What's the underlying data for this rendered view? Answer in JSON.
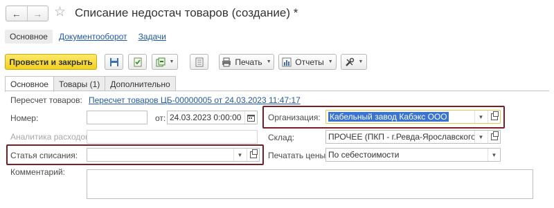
{
  "window": {
    "title": "Списание недостач товаров (создание) *",
    "icons": {
      "back": "arrow-left-icon",
      "forward": "arrow-right-icon",
      "favorite": "star-icon"
    }
  },
  "section_tabs": [
    {
      "label": "Основное"
    },
    {
      "label": "Документооборот"
    },
    {
      "label": "Задачи"
    }
  ],
  "toolbar": {
    "post_close_label": "Провести и закрыть",
    "print_label": "Печать",
    "reports_label": "Отчеты"
  },
  "form_tabs": [
    {
      "label": "Основное"
    },
    {
      "label": "Товары (1)"
    },
    {
      "label": "Дополнительно"
    }
  ],
  "form": {
    "recount_label": "Пересчет товаров:",
    "recount_link": "Пересчет товаров ЦБ-00000005 от 24.03.2023 11:47:17",
    "number_label": "Номер:",
    "number_value": "",
    "date_label": "от:",
    "date_value": "24.03.2023  0:00:00",
    "org_label": "Организация:",
    "org_value": "Кабельный завод Кабэкс ООО",
    "analytics_label": "Аналитика расходов:",
    "analytics_value": "",
    "warehouse_label": "Склад:",
    "warehouse_value": "ПРОЧЕЕ (ПКП - г.Ревда-Ярославского)",
    "writeoff_label": "Статья списания:",
    "writeoff_value": "",
    "price_label": "Печатать цены:",
    "price_value": "По себестоимости",
    "comment_label": "Комментарий:",
    "comment_value": ""
  },
  "colors": {
    "primary_button": "#f3d01d",
    "highlight_border": "#7c1d25",
    "link": "#1f5aa8",
    "selection": "#3a74d0"
  }
}
